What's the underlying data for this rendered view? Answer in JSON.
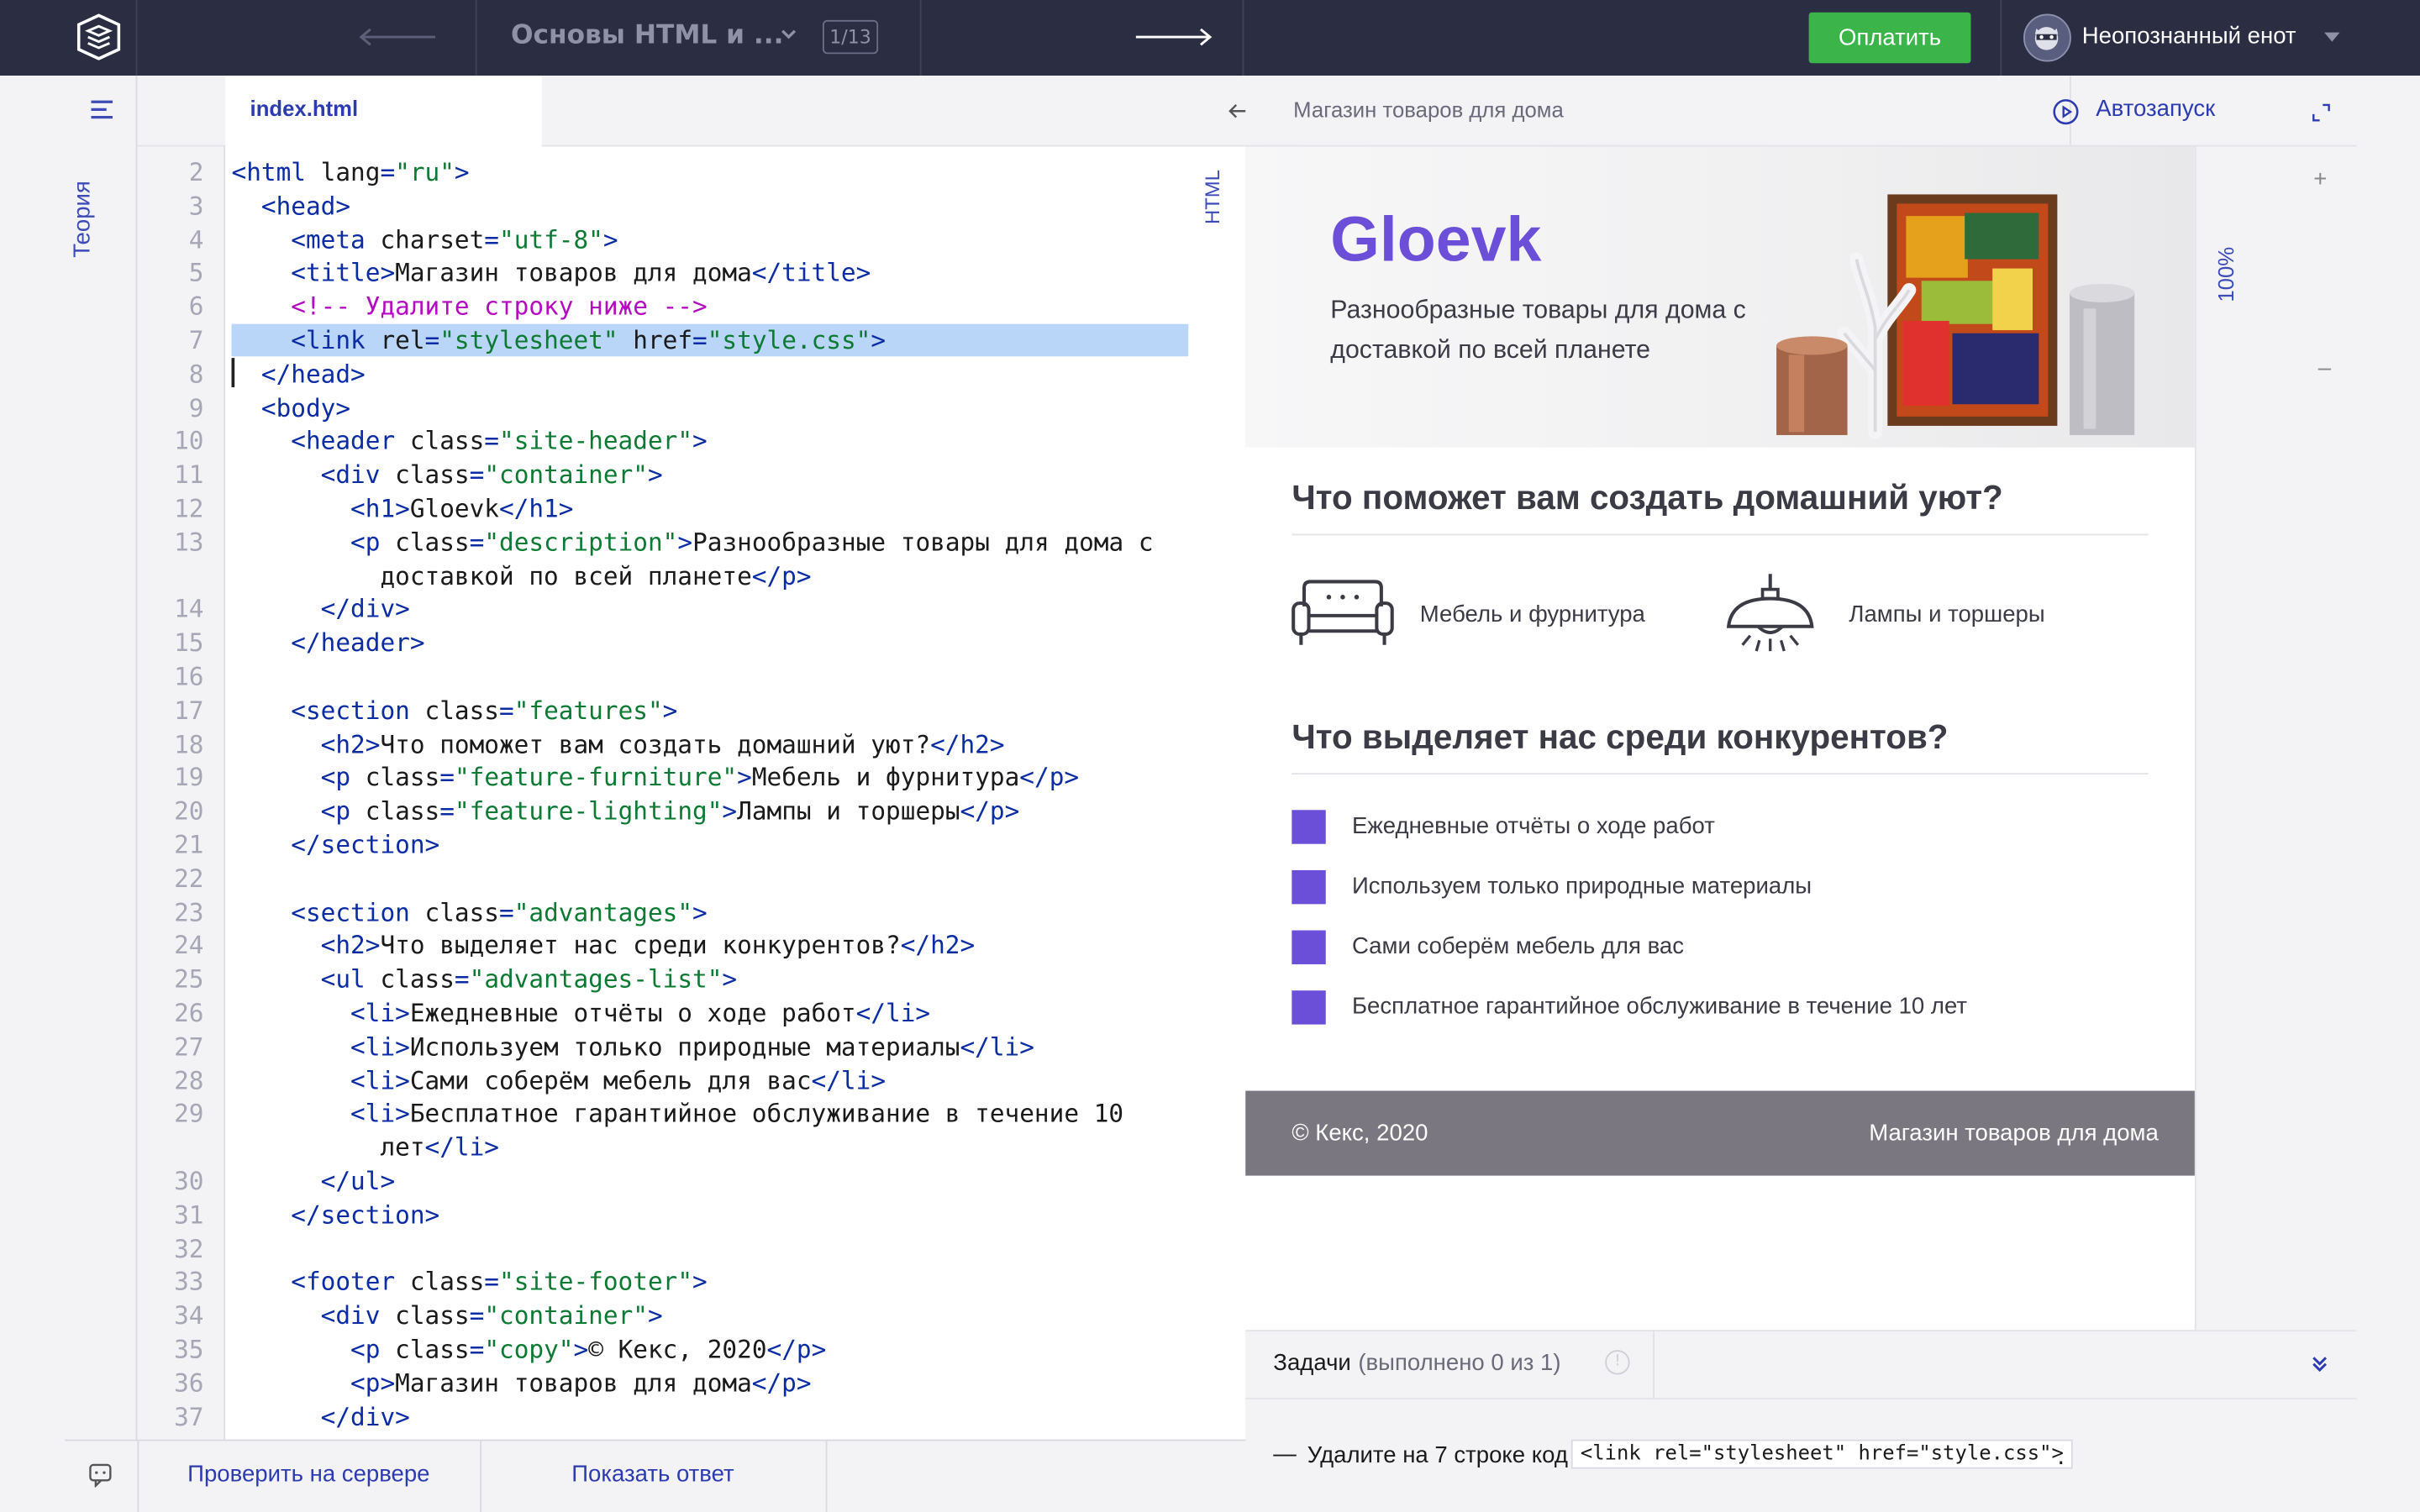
{
  "topbar": {
    "course_title": "Основы HTML и ...",
    "step_counter": "1/13",
    "pay_label": "Оплатить",
    "user_name": "Неопознанный енот"
  },
  "sidebar": {
    "theory_label": "Теория"
  },
  "editor": {
    "file_tab": "index.html",
    "language_label": "HTML",
    "lines": [
      {
        "n": "2",
        "parts": [
          [
            "t",
            "<html "
          ],
          [
            "a",
            "lang"
          ],
          [
            "t",
            "="
          ],
          [
            "v",
            "\"ru\""
          ],
          [
            "t",
            ">"
          ]
        ]
      },
      {
        "n": "3",
        "parts": [
          [
            "",
            "  "
          ],
          [
            "t",
            "<head>"
          ]
        ]
      },
      {
        "n": "4",
        "parts": [
          [
            "",
            "    "
          ],
          [
            "t",
            "<meta "
          ],
          [
            "a",
            "charset"
          ],
          [
            "t",
            "="
          ],
          [
            "v",
            "\"utf-8\""
          ],
          [
            "t",
            ">"
          ]
        ]
      },
      {
        "n": "5",
        "parts": [
          [
            "",
            "    "
          ],
          [
            "t",
            "<title>"
          ],
          [
            "a",
            "Магазин товаров для дома"
          ],
          [
            "t",
            "</title>"
          ]
        ]
      },
      {
        "n": "6",
        "parts": [
          [
            "",
            "    "
          ],
          [
            "c",
            "<!-- Удалите строку ниже -->"
          ]
        ]
      },
      {
        "n": "7",
        "parts": [
          [
            "",
            "    "
          ],
          [
            "t",
            "<link "
          ],
          [
            "a",
            "rel"
          ],
          [
            "t",
            "="
          ],
          [
            "v",
            "\"stylesheet\""
          ],
          [
            "a",
            " href"
          ],
          [
            "t",
            "="
          ],
          [
            "v",
            "\"style.css\""
          ],
          [
            "t",
            ">"
          ]
        ]
      },
      {
        "n": "8",
        "parts": [
          [
            "",
            "  "
          ],
          [
            "t",
            "</head>"
          ]
        ]
      },
      {
        "n": "9",
        "parts": [
          [
            "",
            "  "
          ],
          [
            "t",
            "<body>"
          ]
        ]
      },
      {
        "n": "10",
        "parts": [
          [
            "",
            "    "
          ],
          [
            "t",
            "<header "
          ],
          [
            "a",
            "class"
          ],
          [
            "t",
            "="
          ],
          [
            "v",
            "\"site-header\""
          ],
          [
            "t",
            ">"
          ]
        ]
      },
      {
        "n": "11",
        "parts": [
          [
            "",
            "      "
          ],
          [
            "t",
            "<div "
          ],
          [
            "a",
            "class"
          ],
          [
            "t",
            "="
          ],
          [
            "v",
            "\"container\""
          ],
          [
            "t",
            ">"
          ]
        ]
      },
      {
        "n": "12",
        "parts": [
          [
            "",
            "        "
          ],
          [
            "t",
            "<h1>"
          ],
          [
            "a",
            "Gloevk"
          ],
          [
            "t",
            "</h1>"
          ]
        ]
      },
      {
        "n": "13",
        "parts": [
          [
            "",
            "        "
          ],
          [
            "t",
            "<p "
          ],
          [
            "a",
            "class"
          ],
          [
            "t",
            "="
          ],
          [
            "v",
            "\"description\""
          ],
          [
            "t",
            ">"
          ],
          [
            "a",
            "Разнообразные товары для дома с"
          ]
        ]
      },
      {
        "n": "",
        "parts": [
          [
            "",
            "          "
          ],
          [
            "a",
            "доставкой по всей планете"
          ],
          [
            "t",
            "</p>"
          ]
        ]
      },
      {
        "n": "14",
        "parts": [
          [
            "",
            "      "
          ],
          [
            "t",
            "</div>"
          ]
        ]
      },
      {
        "n": "15",
        "parts": [
          [
            "",
            "    "
          ],
          [
            "t",
            "</header>"
          ]
        ]
      },
      {
        "n": "16",
        "parts": []
      },
      {
        "n": "17",
        "parts": [
          [
            "",
            "    "
          ],
          [
            "t",
            "<section "
          ],
          [
            "a",
            "class"
          ],
          [
            "t",
            "="
          ],
          [
            "v",
            "\"features\""
          ],
          [
            "t",
            ">"
          ]
        ]
      },
      {
        "n": "18",
        "parts": [
          [
            "",
            "      "
          ],
          [
            "t",
            "<h2>"
          ],
          [
            "a",
            "Что поможет вам создать домашний уют?"
          ],
          [
            "t",
            "</h2>"
          ]
        ]
      },
      {
        "n": "19",
        "parts": [
          [
            "",
            "      "
          ],
          [
            "t",
            "<p "
          ],
          [
            "a",
            "class"
          ],
          [
            "t",
            "="
          ],
          [
            "v",
            "\"feature-furniture\""
          ],
          [
            "t",
            ">"
          ],
          [
            "a",
            "Мебель и фурнитура"
          ],
          [
            "t",
            "</p>"
          ]
        ]
      },
      {
        "n": "20",
        "parts": [
          [
            "",
            "      "
          ],
          [
            "t",
            "<p "
          ],
          [
            "a",
            "class"
          ],
          [
            "t",
            "="
          ],
          [
            "v",
            "\"feature-lighting\""
          ],
          [
            "t",
            ">"
          ],
          [
            "a",
            "Лампы и торшеры"
          ],
          [
            "t",
            "</p>"
          ]
        ]
      },
      {
        "n": "21",
        "parts": [
          [
            "",
            "    "
          ],
          [
            "t",
            "</section>"
          ]
        ]
      },
      {
        "n": "22",
        "parts": []
      },
      {
        "n": "23",
        "parts": [
          [
            "",
            "    "
          ],
          [
            "t",
            "<section "
          ],
          [
            "a",
            "class"
          ],
          [
            "t",
            "="
          ],
          [
            "v",
            "\"advantages\""
          ],
          [
            "t",
            ">"
          ]
        ]
      },
      {
        "n": "24",
        "parts": [
          [
            "",
            "      "
          ],
          [
            "t",
            "<h2>"
          ],
          [
            "a",
            "Что выделяет нас среди конкурентов?"
          ],
          [
            "t",
            "</h2>"
          ]
        ]
      },
      {
        "n": "25",
        "parts": [
          [
            "",
            "      "
          ],
          [
            "t",
            "<ul "
          ],
          [
            "a",
            "class"
          ],
          [
            "t",
            "="
          ],
          [
            "v",
            "\"advantages-list\""
          ],
          [
            "t",
            ">"
          ]
        ]
      },
      {
        "n": "26",
        "parts": [
          [
            "",
            "        "
          ],
          [
            "t",
            "<li>"
          ],
          [
            "a",
            "Ежедневные отчёты о ходе работ"
          ],
          [
            "t",
            "</li>"
          ]
        ]
      },
      {
        "n": "27",
        "parts": [
          [
            "",
            "        "
          ],
          [
            "t",
            "<li>"
          ],
          [
            "a",
            "Используем только природные материалы"
          ],
          [
            "t",
            "</li>"
          ]
        ]
      },
      {
        "n": "28",
        "parts": [
          [
            "",
            "        "
          ],
          [
            "t",
            "<li>"
          ],
          [
            "a",
            "Сами соберём мебель для вас"
          ],
          [
            "t",
            "</li>"
          ]
        ]
      },
      {
        "n": "29",
        "parts": [
          [
            "",
            "        "
          ],
          [
            "t",
            "<li>"
          ],
          [
            "a",
            "Бесплатное гарантийное обслуживание в течение 10"
          ]
        ]
      },
      {
        "n": "",
        "parts": [
          [
            "",
            "          "
          ],
          [
            "a",
            "лет"
          ],
          [
            "t",
            "</li>"
          ]
        ]
      },
      {
        "n": "30",
        "parts": [
          [
            "",
            "      "
          ],
          [
            "t",
            "</ul>"
          ]
        ]
      },
      {
        "n": "31",
        "parts": [
          [
            "",
            "    "
          ],
          [
            "t",
            "</section>"
          ]
        ]
      },
      {
        "n": "32",
        "parts": []
      },
      {
        "n": "33",
        "parts": [
          [
            "",
            "    "
          ],
          [
            "t",
            "<footer "
          ],
          [
            "a",
            "class"
          ],
          [
            "t",
            "="
          ],
          [
            "v",
            "\"site-footer\""
          ],
          [
            "t",
            ">"
          ]
        ]
      },
      {
        "n": "34",
        "parts": [
          [
            "",
            "      "
          ],
          [
            "t",
            "<div "
          ],
          [
            "a",
            "class"
          ],
          [
            "t",
            "="
          ],
          [
            "v",
            "\"container\""
          ],
          [
            "t",
            ">"
          ]
        ]
      },
      {
        "n": "35",
        "parts": [
          [
            "",
            "        "
          ],
          [
            "t",
            "<p "
          ],
          [
            "a",
            "class"
          ],
          [
            "t",
            "="
          ],
          [
            "v",
            "\"copy\""
          ],
          [
            "t",
            ">"
          ],
          [
            "a",
            "© Кекс, 2020"
          ],
          [
            "t",
            "</p>"
          ]
        ]
      },
      {
        "n": "36",
        "parts": [
          [
            "",
            "        "
          ],
          [
            "t",
            "<p>"
          ],
          [
            "a",
            "Магазин товаров для дома"
          ],
          [
            "t",
            "</p>"
          ]
        ]
      },
      {
        "n": "37",
        "parts": [
          [
            "",
            "      "
          ],
          [
            "t",
            "</div>"
          ]
        ]
      }
    ]
  },
  "preview": {
    "title": "Магазин товаров для дома",
    "autorun_label": "Автозапуск",
    "zoom_plus": "+",
    "zoom_level": "100%",
    "zoom_minus": "–",
    "brand": "Gloevk",
    "description": "Разнообразные товары для дома с доставкой по всей планете",
    "features_heading": "Что поможет вам создать домашний уют?",
    "feature_furniture": "Мебель и фурнитура",
    "feature_lighting": "Лампы и торшеры",
    "advantages_heading": "Что выделяет нас среди конкурентов?",
    "advantages": [
      "Ежедневные отчёты о ходе работ",
      "Используем только природные материалы",
      "Сами соберём мебель для вас",
      "Бесплатное гарантийное обслуживание в течение 10 лет"
    ],
    "footer_copy": "© Кекс, 2020",
    "footer_shop": "Магазин товаров для дома",
    "accent_color": "#6c4fd9"
  },
  "tasks": {
    "title": "Задачи",
    "count": "(выполнено 0 из 1)",
    "item_dash": "—",
    "item_text": "Удалите на 7 строке код",
    "item_code": "<link rel=\"stylesheet\" href=\"style.css\">",
    "item_end": "."
  },
  "bottombar": {
    "check_label": "Проверить на сервере",
    "answer_label": "Показать ответ"
  }
}
